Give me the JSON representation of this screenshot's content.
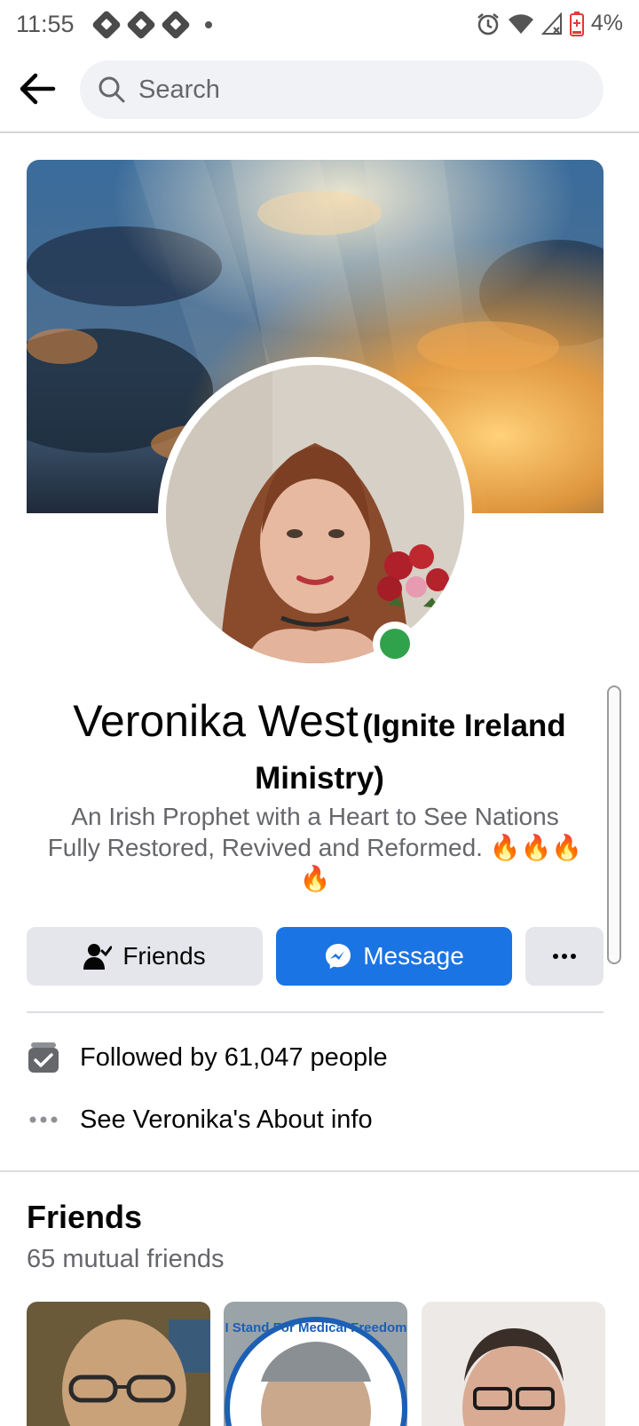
{
  "status_bar": {
    "time": "11:55",
    "battery": "4%"
  },
  "search": {
    "placeholder": "Search"
  },
  "profile": {
    "name": "Veronika West",
    "name_suffix": "(Ignite Ireland Ministry)",
    "bio": "An Irish Prophet with a Heart to See Nations Fully Restored, Revived and Reformed. 🔥🔥🔥🔥",
    "online": true
  },
  "actions": {
    "friends_label": "Friends",
    "message_label": "Message"
  },
  "info": {
    "followers": "Followed by 61,047 people",
    "about": "See Veronika's About info"
  },
  "friends_section": {
    "title": "Friends",
    "subtitle": "65 mutual friends",
    "thumb_2_text": "I Stand For Medical Freedom"
  },
  "colors": {
    "accent": "#1b74e4",
    "online": "#31a24c"
  }
}
